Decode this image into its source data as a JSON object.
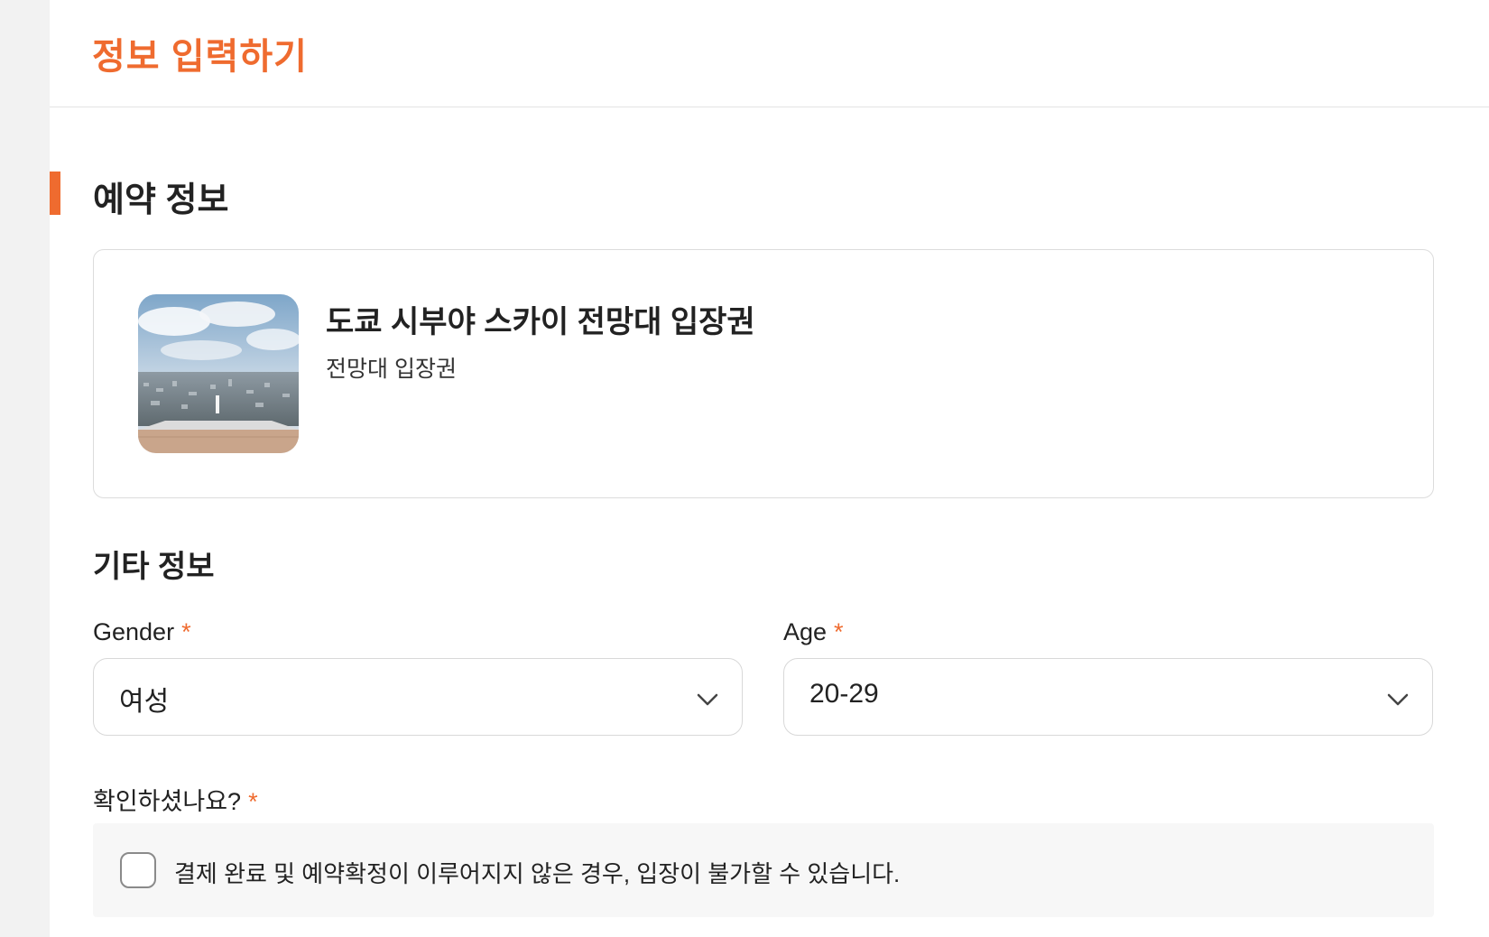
{
  "header": {
    "title": "정보 입력하기"
  },
  "booking_section": {
    "title": "예약 정보",
    "product": {
      "title": "도쿄 시부야 스카이 전망대 입장권",
      "option": "전망대 입장권",
      "thumbnail_icon": "observatory-photo"
    }
  },
  "other_section": {
    "title": "기타 정보",
    "gender": {
      "label": "Gender",
      "required_mark": "*",
      "value": "여성"
    },
    "age": {
      "label": "Age",
      "required_mark": "*",
      "value": "20-29"
    },
    "confirm": {
      "label": "확인하셨나요?",
      "required_mark": "*",
      "checkbox_text": "결제 완료 및 예약확정이 이루어지지 않은 경우, 입장이 불가할 수 있습니다.",
      "checked": false
    }
  },
  "colors": {
    "accent": "#ef6b2f",
    "border": "#d8d8d8",
    "notice_bg": "#f7f7f7"
  }
}
